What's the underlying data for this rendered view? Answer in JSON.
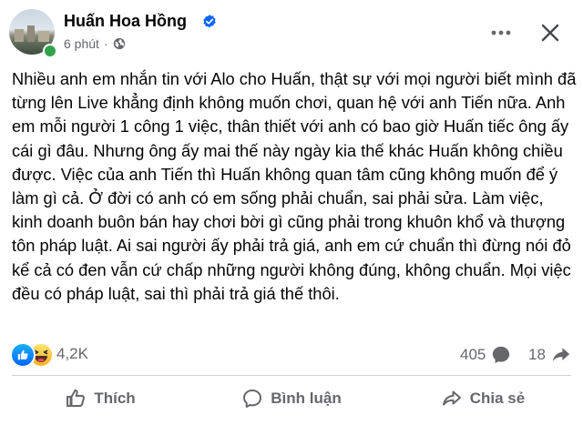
{
  "post": {
    "author": "Huấn Hoa Hồng",
    "time": "6 phút",
    "separator": "·",
    "text": "Nhiều anh em nhắn tin với Alo cho Huấn, thật sự với mọi người biết mình đã từng lên Live khẳng định không muốn chơi, quan hệ với anh Tiến nữa. Anh em mỗi người 1 công 1 việc, thân thiết với anh có bao giờ Huấn tiếc ông ấy cái gì đâu. Nhưng ông ấy mai thế này ngày kia thế khác Huấn không chiều được. Việc của anh Tiến thì Huấn không quan tâm cũng không muốn để ý làm gì cả. Ở đời có anh có em sống phải chuẩn, sai phải sửa. Làm việc, kinh doanh buôn bán hay chơi bời gì cũng phải trong khuôn khổ và thượng tôn pháp luật. Ai sai người ấy phải trả giá, anh em cứ chuẩn thì đừng nói đỏ kể cả có đen vẫn cứ chấp những người không đúng, không chuẩn. Mọi việc đều có pháp luật, sai thì phải trả giá thế thôi."
  },
  "stats": {
    "reactions": "4,2K",
    "comments": "405",
    "shares": "18"
  },
  "actions": {
    "like": "Thích",
    "comment": "Bình luận",
    "share": "Chia sẻ"
  },
  "icons": {
    "verified": "verified-badge-icon",
    "privacy": "globe-icon",
    "more": "more-icon",
    "close": "close-icon",
    "like_reaction": "like-reaction-icon",
    "haha_reaction": "haha-reaction-icon",
    "comment": "comment-icon",
    "share": "share-icon"
  },
  "colors": {
    "accent": "#0866ff",
    "secondary_text": "#65676b",
    "online": "#31a24c"
  }
}
